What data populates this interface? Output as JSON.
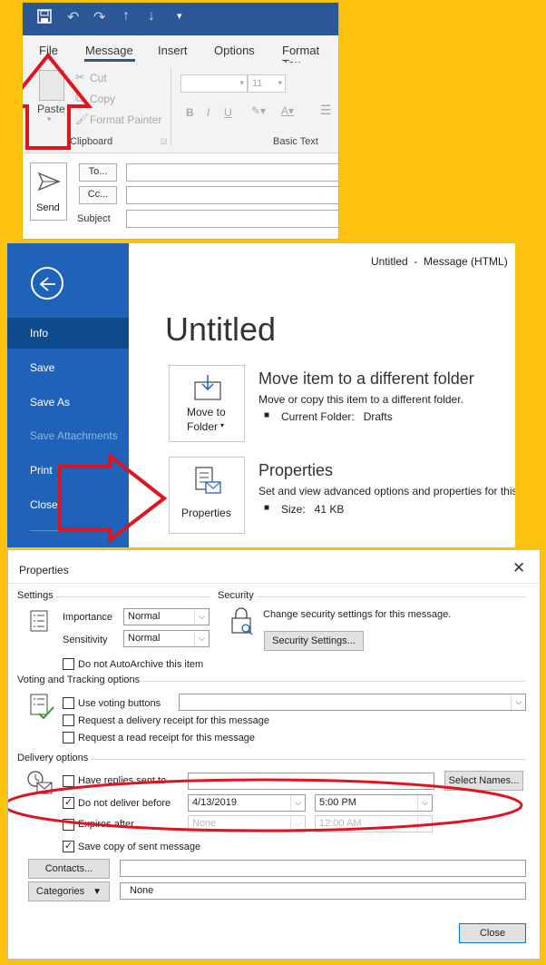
{
  "outlook_window": {
    "qat_icons": [
      "save-icon",
      "undo-icon",
      "redo-icon",
      "up-arrow-icon",
      "down-arrow-icon",
      "customize-dropdown-icon"
    ],
    "tabs": [
      "File",
      "Message",
      "Insert",
      "Options",
      "Format Tex"
    ],
    "clipboard": {
      "paste": "Paste",
      "cut": "Cut",
      "copy": "Copy",
      "format_painter": "Format Painter",
      "group": "Clipboard"
    },
    "basic_text": {
      "font_size": "11",
      "group": "Basic Text"
    },
    "compose": {
      "send": "Send",
      "to": "To...",
      "cc": "Cc...",
      "subject": "Subject"
    }
  },
  "backstage": {
    "title_bar": "Untitled  -  Message (HTML)",
    "menu": [
      "Info",
      "Save",
      "Save As",
      "Save Attachments",
      "Print",
      "Close"
    ],
    "heading": "Untitled",
    "move_tile": {
      "line1": "Move to",
      "line2": "Folder"
    },
    "move_section": {
      "title": "Move item to a different folder",
      "desc": "Move or copy this item to a different folder.",
      "bullet": "Current Folder:   Drafts"
    },
    "properties_tile": "Properties",
    "properties_section": {
      "title": "Properties",
      "desc": "Set and view advanced options and properties for this",
      "bullet": "Size:   41 KB"
    }
  },
  "dialog": {
    "title": "Properties",
    "settings": {
      "heading": "Settings",
      "importance_label": "Importance",
      "importance": "Normal",
      "sensitivity_label": "Sensitivity",
      "sensitivity": "Normal",
      "autoarchive": "Do not AutoArchive this item"
    },
    "security": {
      "heading": "Security",
      "desc": "Change security settings for this message.",
      "button": "Security Settings..."
    },
    "voting": {
      "heading": "Voting and Tracking options",
      "use_voting": "Use voting buttons",
      "delivery_receipt": "Request a delivery receipt for this message",
      "read_receipt": "Request a read receipt for this message"
    },
    "delivery": {
      "heading": "Delivery options",
      "have_replies": "Have replies sent to",
      "select_names": "Select Names...",
      "do_not_deliver": "Do not deliver before",
      "deliver_date": "4/13/2019",
      "deliver_time": "5:00 PM",
      "expires": "Expires after",
      "expires_date": "None",
      "expires_time": "12:00 AM",
      "save_copy": "Save copy of sent message"
    },
    "contacts_button": "Contacts...",
    "categories_button": "Categories",
    "categories_value": "None",
    "close_button": "Close"
  },
  "colors": {
    "background": "#fcc20e",
    "annotation": "#e0141e",
    "backstage_blue": "#1e63b9",
    "title_bar": "#2b5797"
  }
}
